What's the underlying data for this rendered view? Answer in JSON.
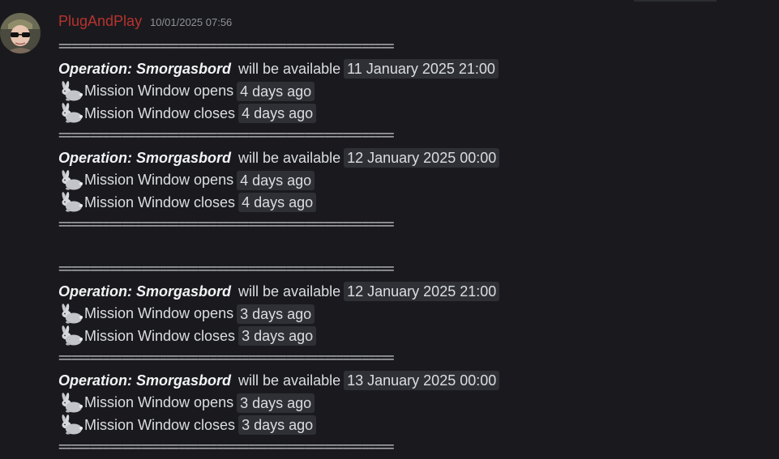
{
  "message": {
    "username": "PlugAndPlay",
    "timestamp": "10/01/2025 07:56",
    "username_color": "#b8322f"
  },
  "separator": "=====================================================",
  "blocks": [
    {
      "operation": "Operation: Smorgasbord",
      "available_text": "will be available",
      "available_at": "11 January 2025 21:00",
      "opens_label": "Mission Window opens",
      "opens_rel": "4 days ago",
      "closes_label": "Mission Window closes",
      "closes_rel": "4 days ago"
    },
    {
      "operation": "Operation: Smorgasbord",
      "available_text": "will be available",
      "available_at": "12 January 2025 00:00",
      "opens_label": "Mission Window opens",
      "opens_rel": "4 days ago",
      "closes_label": "Mission Window closes",
      "closes_rel": "4 days ago"
    },
    {
      "operation": "Operation: Smorgasbord",
      "available_text": "will be available",
      "available_at": "12 January 2025 21:00",
      "opens_label": "Mission Window opens",
      "opens_rel": "3 days ago",
      "closes_label": "Mission Window closes",
      "closes_rel": "3 days ago"
    },
    {
      "operation": "Operation: Smorgasbord",
      "available_text": "will be available",
      "available_at": "13 January 2025 00:00",
      "opens_label": "Mission Window opens",
      "opens_rel": "3 days ago",
      "closes_label": "Mission Window closes",
      "closes_rel": "3 days ago"
    }
  ],
  "icons": {
    "line_icon": "rabbit-icon"
  }
}
